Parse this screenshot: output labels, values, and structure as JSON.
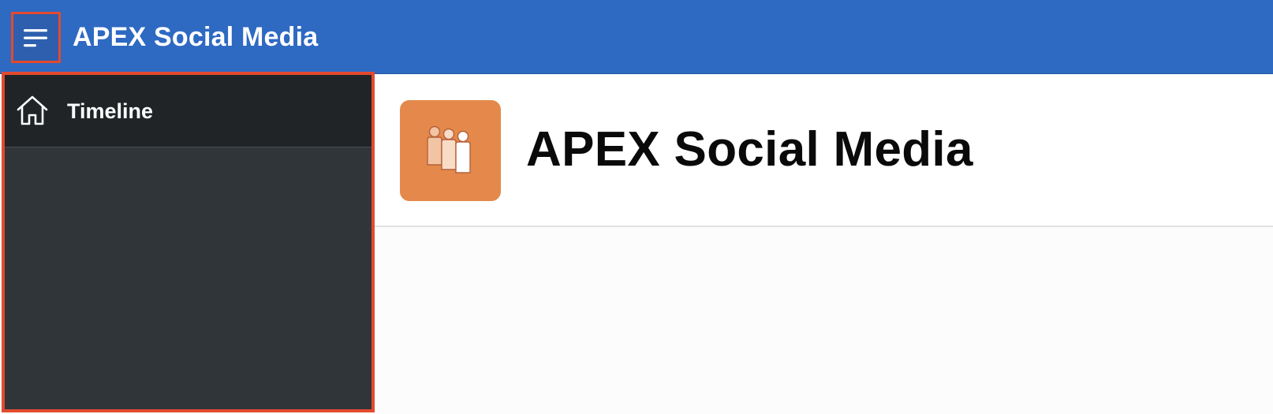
{
  "header": {
    "app_title": "APEX Social Media",
    "menu_icon": "hamburger-menu-icon",
    "background_color": "#2e69c2"
  },
  "sidebar": {
    "items": [
      {
        "label": "Timeline",
        "icon": "home-icon",
        "selected": true
      }
    ],
    "background_color": "#30353a",
    "highlight_color": "#e34a2f"
  },
  "main": {
    "hero": {
      "title": "APEX Social Media",
      "icon": "people-group-icon",
      "icon_background": "#e4894b"
    }
  }
}
